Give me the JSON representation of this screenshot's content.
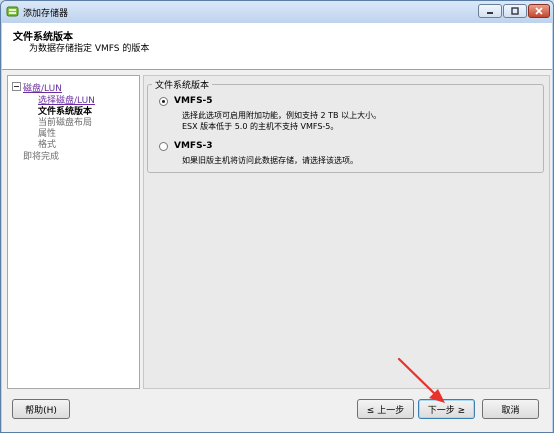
{
  "window": {
    "title": "添加存储器",
    "controls": {
      "minimize": "−",
      "maximize": "□",
      "close": "✕"
    }
  },
  "header": {
    "title": "文件系统版本",
    "subtitle": "为数据存储指定 VMFS 的版本"
  },
  "nav": {
    "items": [
      {
        "label": "磁盘/LUN",
        "state": "link"
      },
      {
        "label": "选择磁盘/LUN",
        "state": "link"
      },
      {
        "label": "文件系统版本",
        "state": "current"
      },
      {
        "label": "当前磁盘布局",
        "state": "disabled"
      },
      {
        "label": "属性",
        "state": "disabled"
      },
      {
        "label": "格式",
        "state": "disabled"
      },
      {
        "label": "即将完成",
        "state": "disabled"
      }
    ]
  },
  "content": {
    "group_title": "文件系统版本",
    "options": [
      {
        "label": "VMFS-5",
        "selected": true,
        "desc1": "选择此选项可启用附加功能，例如支持 2 TB 以上大小。",
        "desc2": "ESX 版本低于 5.0 的主机不支持 VMFS-5。"
      },
      {
        "label": "VMFS-3",
        "selected": false,
        "desc1": "如果旧版主机将访问此数据存储，请选择该选项。"
      }
    ]
  },
  "footer": {
    "help": "帮助(H)",
    "back": "≤ 上一步",
    "next": "下一步 ≥",
    "cancel": "取消"
  },
  "colors": {
    "accent": "#e8322c",
    "link": "#6b2ea1",
    "title_bar": "#bed3ee"
  }
}
